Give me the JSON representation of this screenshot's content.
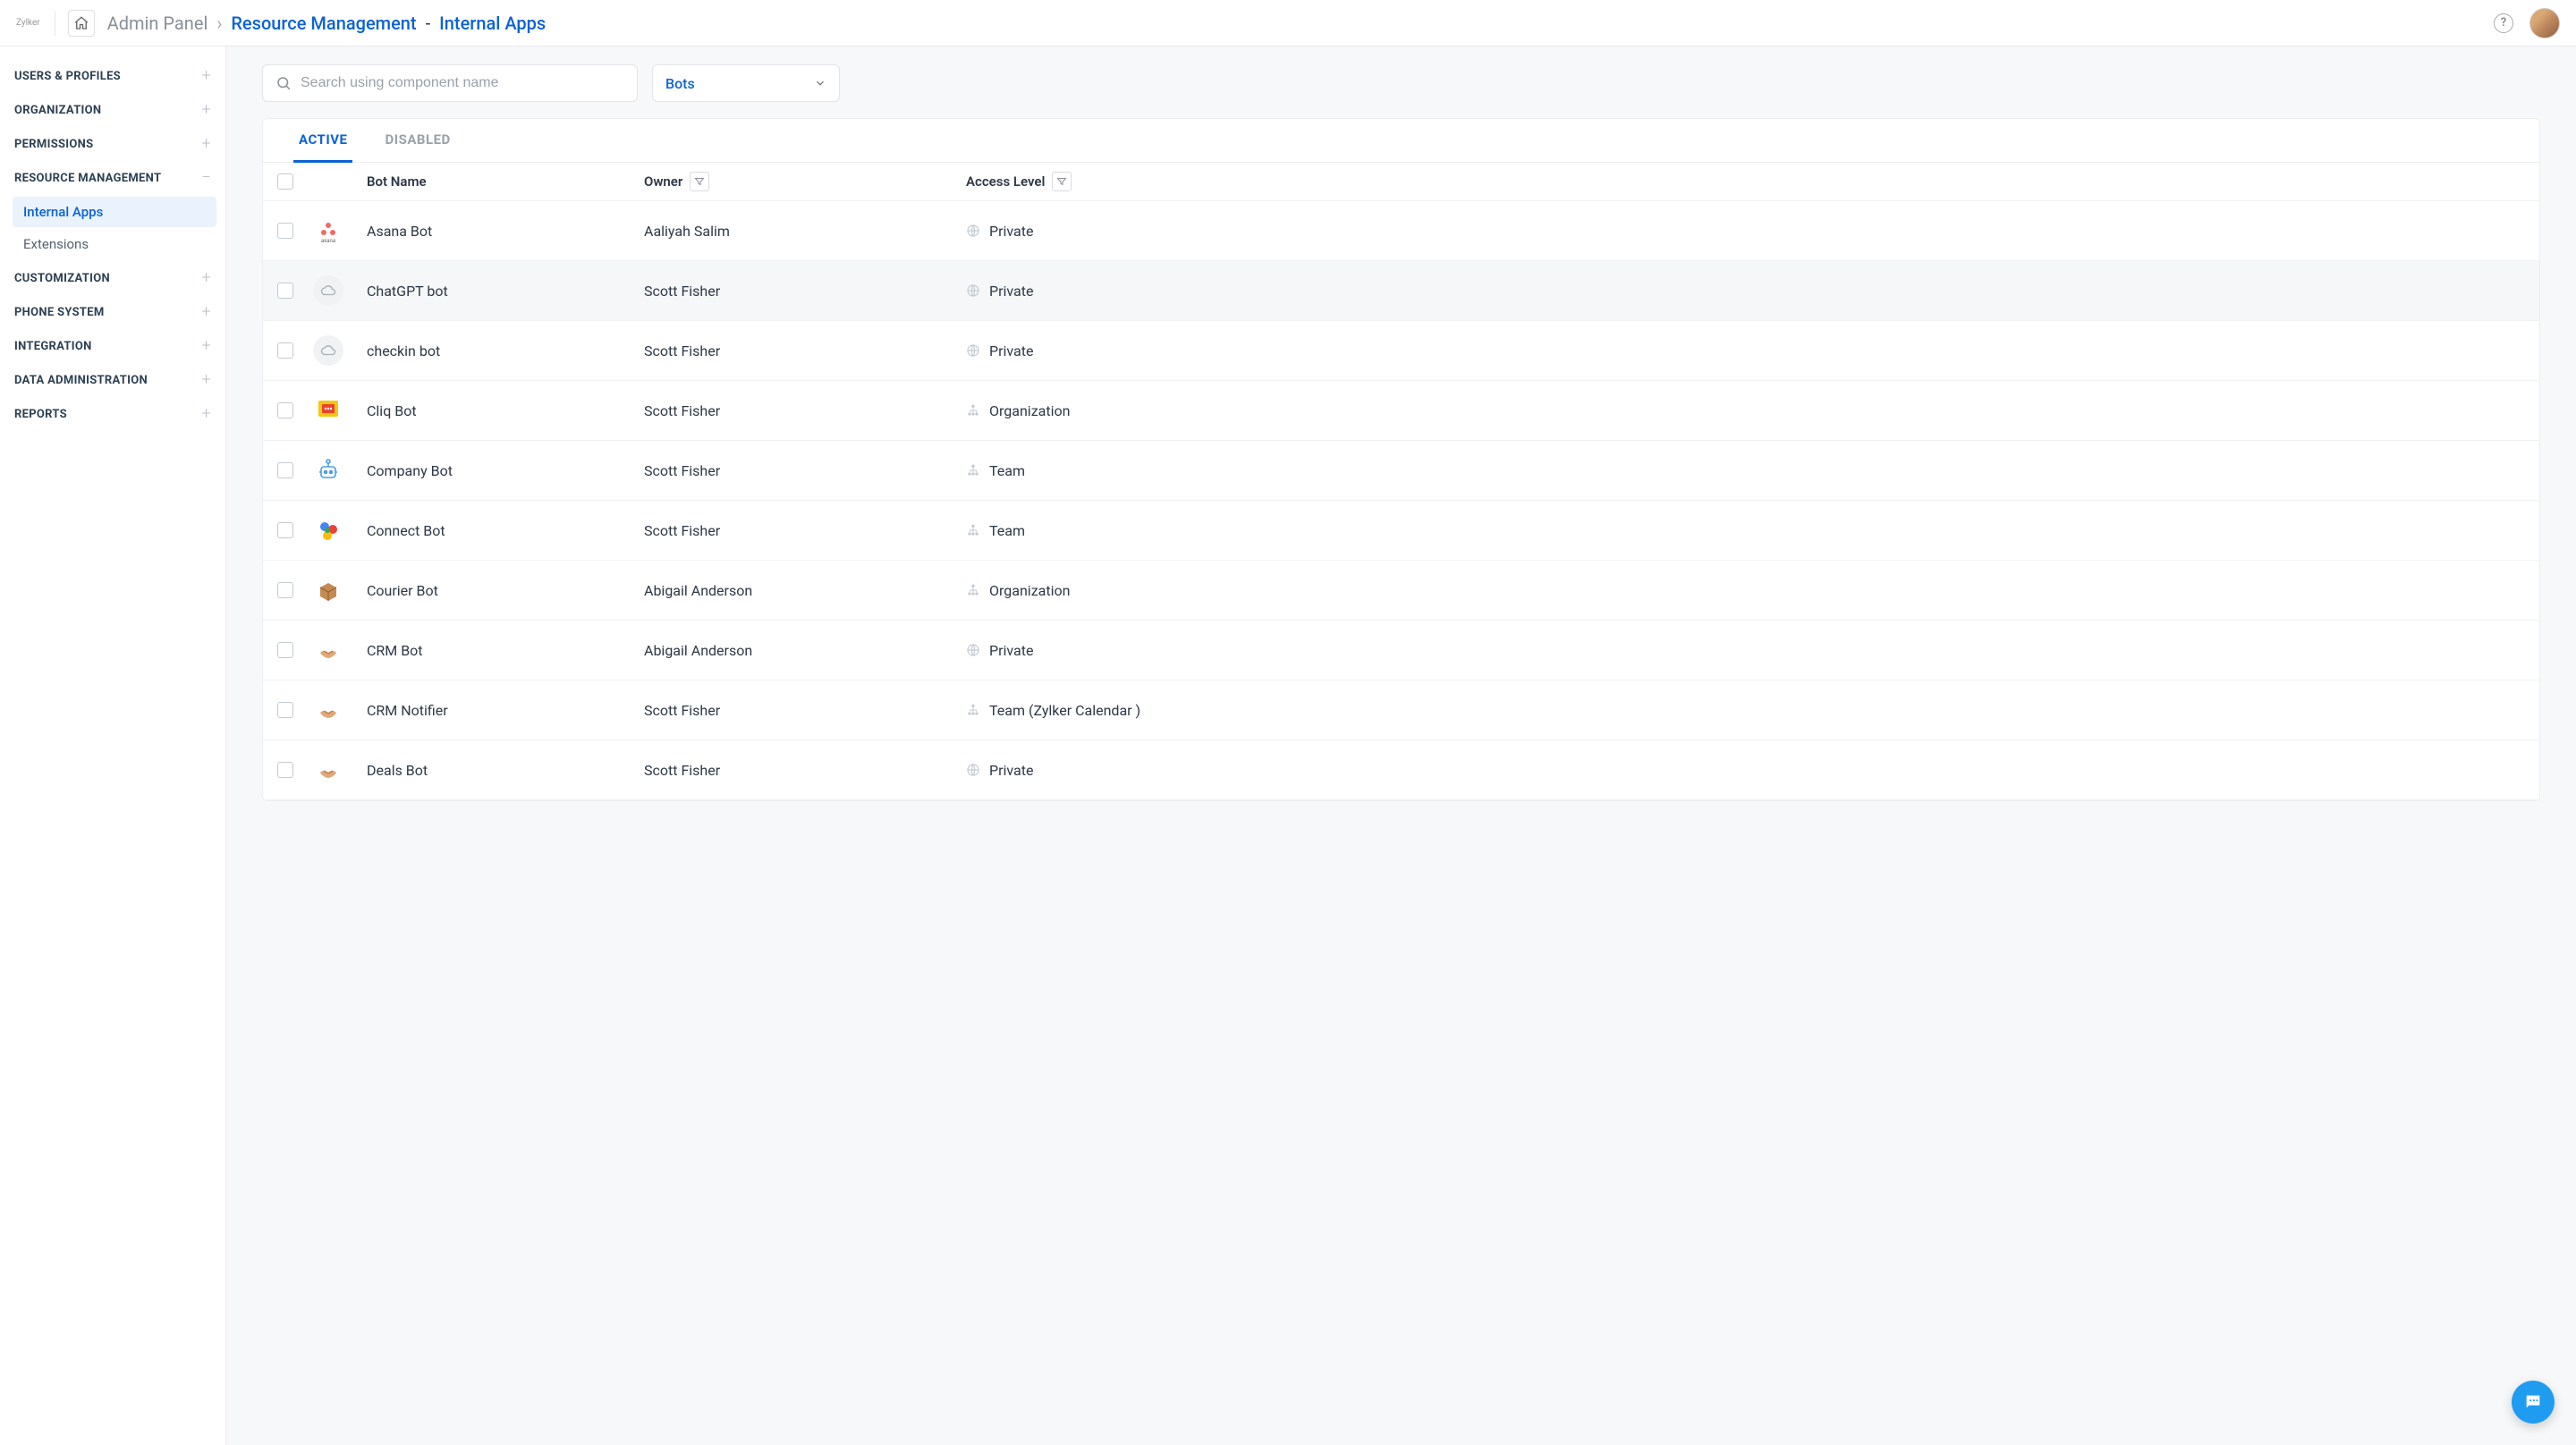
{
  "header": {
    "logo": "Zylker",
    "breadcrumb": {
      "root": "Admin Panel",
      "section": "Resource Management",
      "page": "Internal Apps"
    }
  },
  "sidebar": {
    "sections": [
      {
        "label": "USERS & PROFILES",
        "expanded": false
      },
      {
        "label": "ORGANIZATION",
        "expanded": false
      },
      {
        "label": "PERMISSIONS",
        "expanded": false
      },
      {
        "label": "RESOURCE MANAGEMENT",
        "expanded": true,
        "children": [
          {
            "label": "Internal Apps",
            "active": true
          },
          {
            "label": "Extensions",
            "active": false
          }
        ]
      },
      {
        "label": "CUSTOMIZATION",
        "expanded": false
      },
      {
        "label": "PHONE SYSTEM",
        "expanded": false
      },
      {
        "label": "INTEGRATION",
        "expanded": false
      },
      {
        "label": "DATA ADMINISTRATION",
        "expanded": false
      },
      {
        "label": "REPORTS",
        "expanded": false
      }
    ]
  },
  "controls": {
    "search_placeholder": "Search using component name",
    "dropdown_selected": "Bots"
  },
  "tabs": [
    {
      "label": "ACTIVE",
      "active": true
    },
    {
      "label": "DISABLED",
      "active": false
    }
  ],
  "columns": {
    "name": "Bot Name",
    "owner": "Owner",
    "access": "Access Level"
  },
  "rows": [
    {
      "icon": "asana",
      "name": "Asana Bot",
      "owner": "Aaliyah Salim",
      "access": "Private",
      "access_kind": "private"
    },
    {
      "icon": "cloud",
      "name": "ChatGPT bot",
      "owner": "Scott Fisher",
      "access": "Private",
      "access_kind": "private",
      "highlight": true
    },
    {
      "icon": "cloud",
      "name": "checkin bot",
      "owner": "Scott Fisher",
      "access": "Private",
      "access_kind": "private"
    },
    {
      "icon": "cliq",
      "name": "Cliq Bot",
      "owner": "Scott Fisher",
      "access": "Organization",
      "access_kind": "org"
    },
    {
      "icon": "robot",
      "name": "Company Bot",
      "owner": "Scott Fisher",
      "access": "Team",
      "access_kind": "team"
    },
    {
      "icon": "connect",
      "name": "Connect Bot",
      "owner": "Scott Fisher",
      "access": "Team",
      "access_kind": "team"
    },
    {
      "icon": "box",
      "name": "Courier Bot",
      "owner": "Abigail Anderson",
      "access": "Organization",
      "access_kind": "org"
    },
    {
      "icon": "hands",
      "name": "CRM Bot",
      "owner": "Abigail Anderson",
      "access": "Private",
      "access_kind": "private"
    },
    {
      "icon": "hands",
      "name": "CRM Notifier",
      "owner": "Scott Fisher",
      "access": "Team (Zylker Calendar )",
      "access_kind": "team"
    },
    {
      "icon": "hands",
      "name": "Deals Bot",
      "owner": "Scott Fisher",
      "access": "Private",
      "access_kind": "private"
    }
  ]
}
